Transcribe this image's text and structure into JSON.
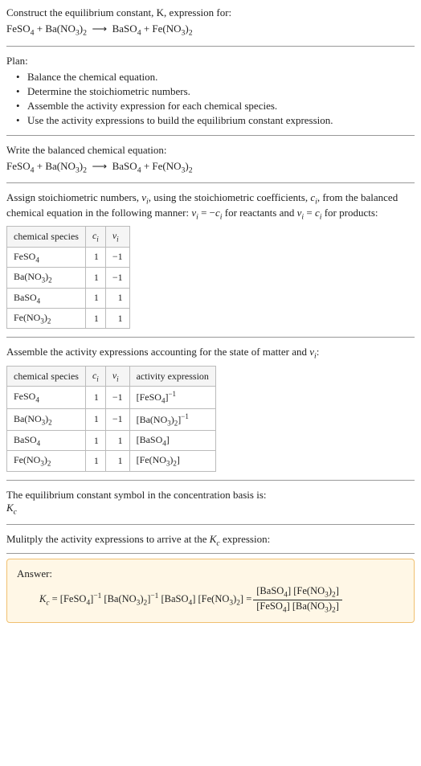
{
  "prompt": {
    "line1": "Construct the equilibrium constant, K, expression for:",
    "reaction_html": "FeSO<sub>4</sub> + Ba(NO<sub>3</sub>)<sub>2</sub> &nbsp;⟶&nbsp; BaSO<sub>4</sub> + Fe(NO<sub>3</sub>)<sub>2</sub>"
  },
  "plan": {
    "heading": "Plan:",
    "items": [
      "Balance the chemical equation.",
      "Determine the stoichiometric numbers.",
      "Assemble the activity expression for each chemical species.",
      "Use the activity expressions to build the equilibrium constant expression."
    ]
  },
  "balanced": {
    "heading": "Write the balanced chemical equation:",
    "reaction_html": "FeSO<sub>4</sub> + Ba(NO<sub>3</sub>)<sub>2</sub> &nbsp;⟶&nbsp; BaSO<sub>4</sub> + Fe(NO<sub>3</sub>)<sub>2</sub>"
  },
  "stoich": {
    "intro_html": "Assign stoichiometric numbers, <span class='italic'>ν<sub>i</sub></span>, using the stoichiometric coefficients, <span class='italic'>c<sub>i</sub></span>, from the balanced chemical equation in the following manner: <span class='italic'>ν<sub>i</sub></span> = −<span class='italic'>c<sub>i</sub></span> for reactants and <span class='italic'>ν<sub>i</sub></span> = <span class='italic'>c<sub>i</sub></span> for products:",
    "headers": {
      "species": "chemical species",
      "ci_html": "<span class='italic'>c<sub>i</sub></span>",
      "vi_html": "<span class='italic'>ν<sub>i</sub></span>"
    },
    "rows": [
      {
        "species_html": "FeSO<sub>4</sub>",
        "ci": "1",
        "vi": "−1"
      },
      {
        "species_html": "Ba(NO<sub>3</sub>)<sub>2</sub>",
        "ci": "1",
        "vi": "−1"
      },
      {
        "species_html": "BaSO<sub>4</sub>",
        "ci": "1",
        "vi": "1"
      },
      {
        "species_html": "Fe(NO<sub>3</sub>)<sub>2</sub>",
        "ci": "1",
        "vi": "1"
      }
    ]
  },
  "activity": {
    "intro_html": "Assemble the activity expressions accounting for the state of matter and <span class='italic'>ν<sub>i</sub></span>:",
    "headers": {
      "species": "chemical species",
      "ci_html": "<span class='italic'>c<sub>i</sub></span>",
      "vi_html": "<span class='italic'>ν<sub>i</sub></span>",
      "act": "activity expression"
    },
    "rows": [
      {
        "species_html": "FeSO<sub>4</sub>",
        "ci": "1",
        "vi": "−1",
        "act_html": "[FeSO<sub>4</sub>]<sup>−1</sup>"
      },
      {
        "species_html": "Ba(NO<sub>3</sub>)<sub>2</sub>",
        "ci": "1",
        "vi": "−1",
        "act_html": "[Ba(NO<sub>3</sub>)<sub>2</sub>]<sup>−1</sup>"
      },
      {
        "species_html": "BaSO<sub>4</sub>",
        "ci": "1",
        "vi": "1",
        "act_html": "[BaSO<sub>4</sub>]"
      },
      {
        "species_html": "Fe(NO<sub>3</sub>)<sub>2</sub>",
        "ci": "1",
        "vi": "1",
        "act_html": "[Fe(NO<sub>3</sub>)<sub>2</sub>]"
      }
    ]
  },
  "symbol": {
    "line1": "The equilibrium constant symbol in the concentration basis is:",
    "kc_html": "<span class='italic'>K<sub>c</sub></span>"
  },
  "multiply": {
    "line_html": "Mulitply the activity expressions to arrive at the <span class='italic'>K<sub>c</sub></span> expression:"
  },
  "answer": {
    "label": "Answer:",
    "lhs_html": "<span class='italic'>K<sub>c</sub></span> = [FeSO<sub>4</sub>]<sup>−1</sup> [Ba(NO<sub>3</sub>)<sub>2</sub>]<sup>−1</sup> [BaSO<sub>4</sub>] [Fe(NO<sub>3</sub>)<sub>2</sub>] = ",
    "frac_num_html": "[BaSO<sub>4</sub>] [Fe(NO<sub>3</sub>)<sub>2</sub>]",
    "frac_den_html": "[FeSO<sub>4</sub>] [Ba(NO<sub>3</sub>)<sub>2</sub>]"
  }
}
